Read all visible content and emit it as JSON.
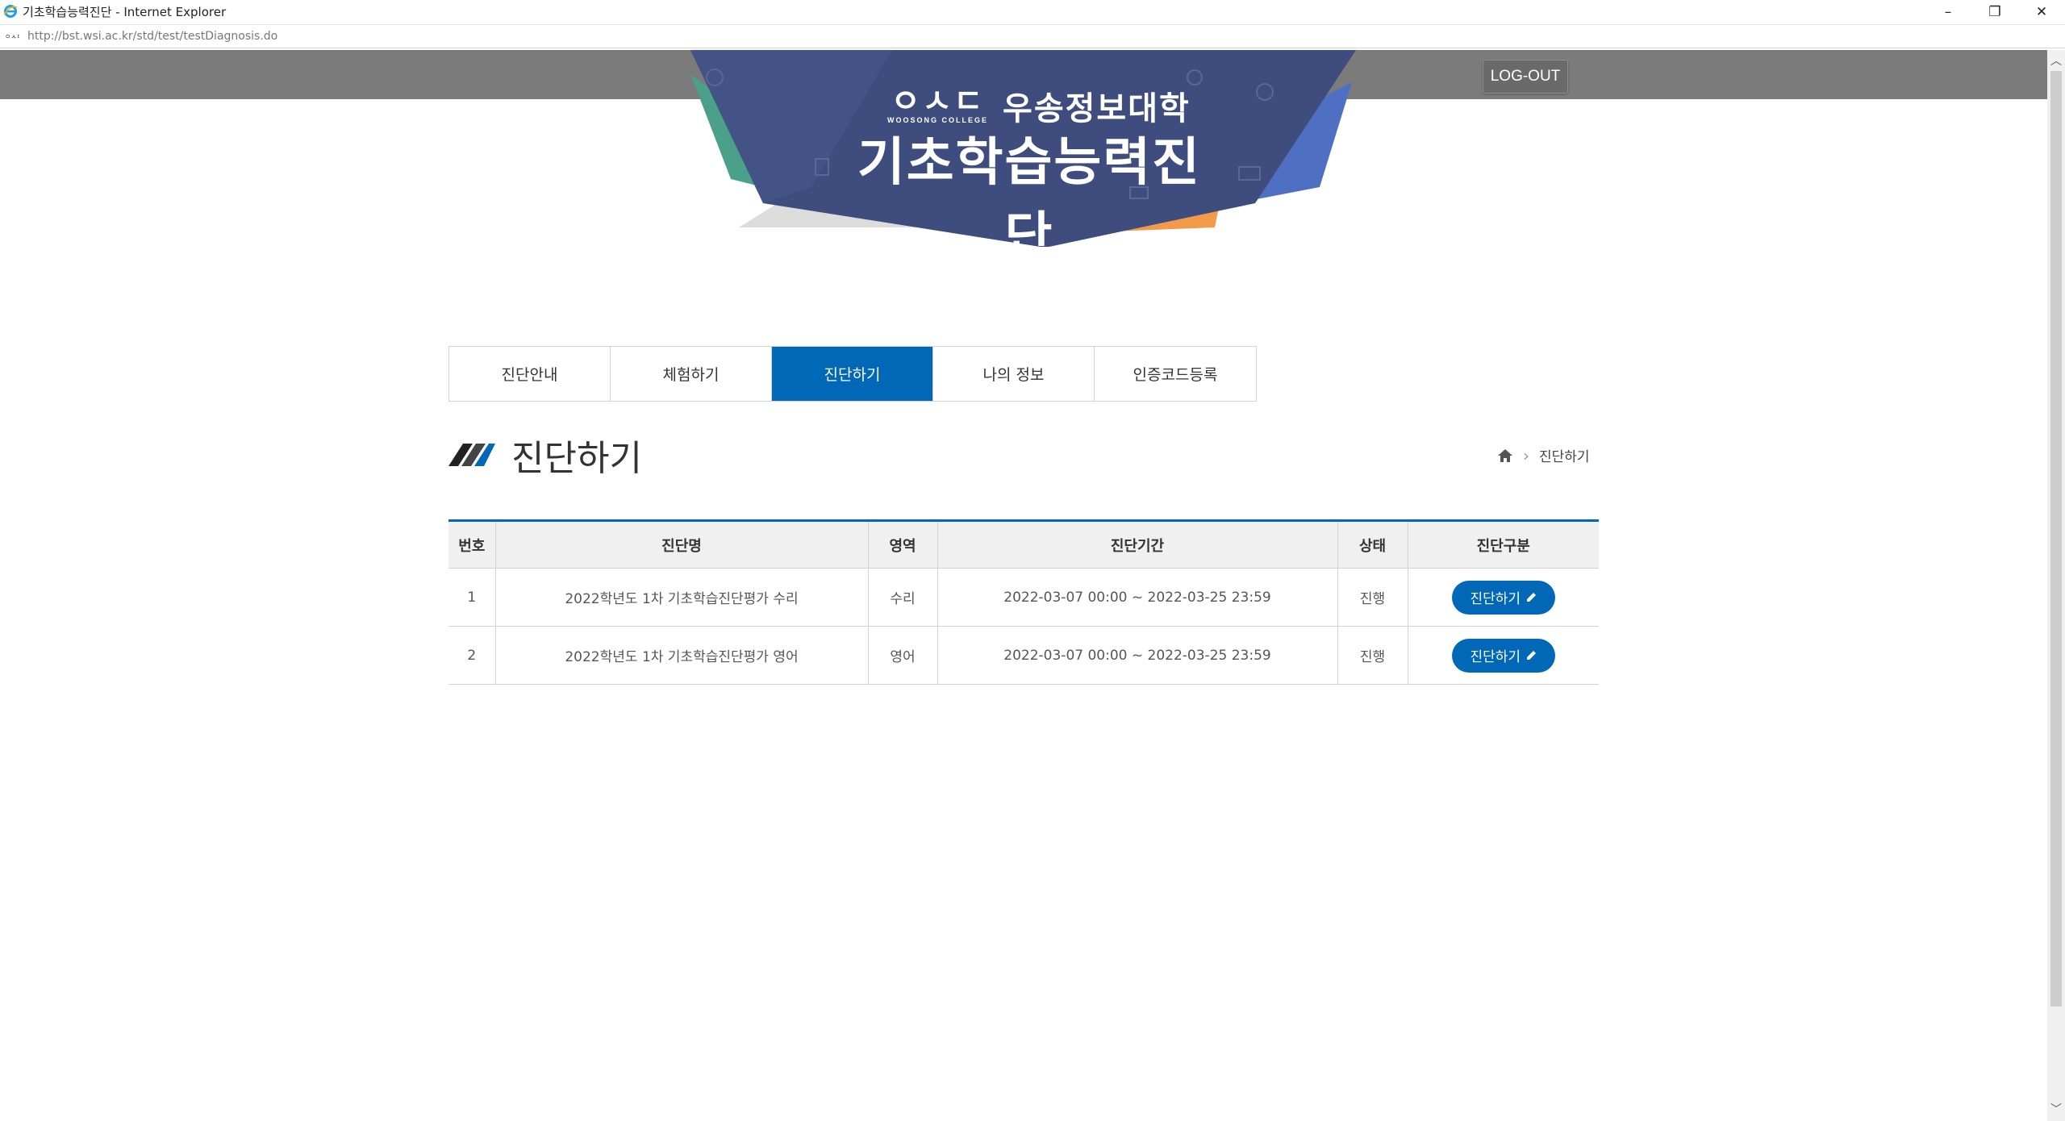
{
  "window": {
    "title": "기초학습능력진단 - Internet Explorer",
    "minimize": "–",
    "restore": "❐",
    "close": "✕"
  },
  "address": {
    "url": "http://bst.wsi.ac.kr/std/test/testDiagnosis.do"
  },
  "header": {
    "logout_label": "LOG-OUT",
    "brand_mark": "ㅇㅅㄷ",
    "brand_sub": "WOOSONG COLLEGE",
    "brand_name": "우송정보대학",
    "banner_title": "기초학습능력진단"
  },
  "tabs": [
    {
      "label": "진단안내",
      "active": false
    },
    {
      "label": "체험하기",
      "active": false
    },
    {
      "label": "진단하기",
      "active": true
    },
    {
      "label": "나의 정보",
      "active": false
    },
    {
      "label": "인증코드등록",
      "active": false
    }
  ],
  "page": {
    "title": "진단하기",
    "breadcrumb_current": "진단하기"
  },
  "table": {
    "columns": [
      "번호",
      "진단명",
      "영역",
      "진단기간",
      "상태",
      "진단구분"
    ],
    "rows": [
      {
        "no": "1",
        "name": "2022학년도 1차 기초학습진단평가 수리",
        "area": "수리",
        "period": "2022-03-07 00:00 ~ 2022-03-25 23:59",
        "status": "진행",
        "action": "진단하기"
      },
      {
        "no": "2",
        "name": "2022학년도 1차 기초학습진단평가 영어",
        "area": "영어",
        "period": "2022-03-07 00:00 ~ 2022-03-25 23:59",
        "status": "진행",
        "action": "진단하기"
      }
    ]
  },
  "colors": {
    "primary": "#0068b7",
    "header_bar": "#7b7b7b",
    "banner_navy": "#3f4d7e",
    "banner_green": "#4aa088",
    "banner_blue": "#4e6fc2",
    "banner_orange": "#f09a4a"
  }
}
